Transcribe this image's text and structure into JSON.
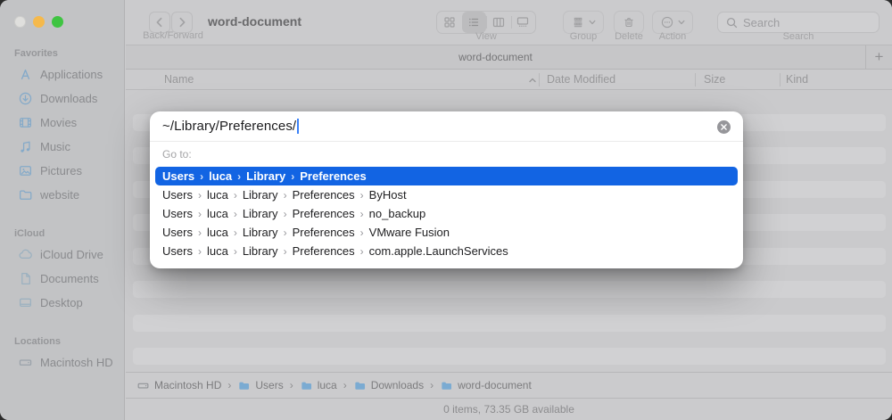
{
  "window": {
    "title": "word-document",
    "traffic_lights": {
      "close": "#dfdfdd",
      "minimize": "#f5b94c",
      "zoom": "#3fc442"
    }
  },
  "sidebar": {
    "sections": [
      {
        "title": "Favorites",
        "items": [
          {
            "label": "Applications",
            "icon": "applications-icon"
          },
          {
            "label": "Downloads",
            "icon": "downloads-icon"
          },
          {
            "label": "Movies",
            "icon": "movies-icon"
          },
          {
            "label": "Music",
            "icon": "music-icon"
          },
          {
            "label": "Pictures",
            "icon": "pictures-icon"
          },
          {
            "label": "website",
            "icon": "folder-icon"
          }
        ]
      },
      {
        "title": "iCloud",
        "items": [
          {
            "label": "iCloud Drive",
            "icon": "icloud-icon"
          },
          {
            "label": "Documents",
            "icon": "document-icon"
          },
          {
            "label": "Desktop",
            "icon": "desktop-icon"
          }
        ]
      },
      {
        "title": "Locations",
        "items": [
          {
            "label": "Macintosh HD",
            "icon": "hard-drive-icon"
          }
        ]
      }
    ]
  },
  "toolbar": {
    "back_forward_label": "Back/Forward",
    "view_label": "View",
    "group_label": "Group",
    "delete_label": "Delete",
    "action_label": "Action",
    "search_label": "Search",
    "search_placeholder": "Search"
  },
  "tab_bar": {
    "active_tab": "word-document",
    "new_tab_glyph": "+"
  },
  "list_header": {
    "columns": [
      "Name",
      "Date Modified",
      "Size",
      "Kind"
    ],
    "sort_column": "Name",
    "sort_direction": "ascending"
  },
  "dialog": {
    "input_value": "~/Library/Preferences/",
    "goto_label": "Go to:",
    "selection_color": "#1264e3",
    "suggestions": [
      {
        "selected": true,
        "segments": [
          "Users",
          "luca",
          "Library",
          "Preferences"
        ]
      },
      {
        "selected": false,
        "segments": [
          "Users",
          "luca",
          "Library",
          "Preferences",
          "ByHost"
        ]
      },
      {
        "selected": false,
        "segments": [
          "Users",
          "luca",
          "Library",
          "Preferences",
          "no_backup"
        ]
      },
      {
        "selected": false,
        "segments": [
          "Users",
          "luca",
          "Library",
          "Preferences",
          "VMware Fusion"
        ]
      },
      {
        "selected": false,
        "segments": [
          "Users",
          "luca",
          "Library",
          "Preferences",
          "com.apple.LaunchServices"
        ]
      }
    ]
  },
  "path_bar": {
    "items": [
      {
        "label": "Macintosh HD",
        "icon": "hard-drive-icon"
      },
      {
        "label": "Users",
        "icon": "folder-icon"
      },
      {
        "label": "luca",
        "icon": "folder-icon"
      },
      {
        "label": "Downloads",
        "icon": "folder-icon"
      },
      {
        "label": "word-document",
        "icon": "folder-icon"
      }
    ],
    "separator": "›"
  },
  "status_bar": {
    "text": "0 items, 73.35 GB available"
  }
}
